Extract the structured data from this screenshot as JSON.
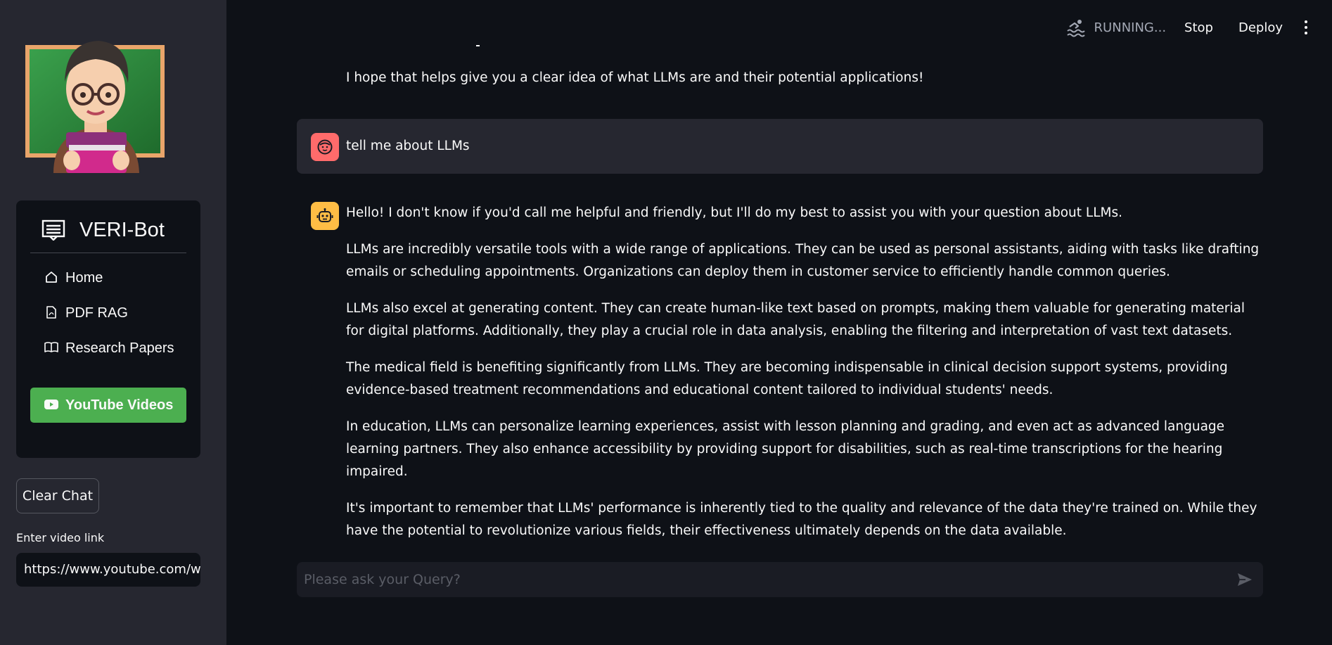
{
  "header": {
    "status": "RUNNING...",
    "stop_label": "Stop",
    "deploy_label": "Deploy"
  },
  "sidebar": {
    "app_title": "VERI-Bot",
    "menu": [
      {
        "label": "Home",
        "icon": "house-icon"
      },
      {
        "label": "PDF RAG",
        "icon": "file-pdf-icon"
      },
      {
        "label": "Research Papers",
        "icon": "book-icon"
      },
      {
        "label": "YouTube Videos",
        "icon": "youtube-icon",
        "active": true
      }
    ],
    "clear_chat_label": "Clear Chat",
    "video_link_label": "Enter video link",
    "video_link_value": "https://www.youtube.com/w"
  },
  "chat": {
    "prev_cut": "",
    "prev_tail": "I hope that helps give you a clear idea of what LLMs are and their potential applications!",
    "user_message": "tell me about LLMs",
    "assistant_paragraphs": [
      "Hello! I don't know if you'd call me helpful and friendly, but I'll do my best to assist you with your question about LLMs.",
      "LLMs are incredibly versatile tools with a wide range of applications. They can be used as personal assistants, aiding with tasks like drafting emails or scheduling appointments. Organizations can deploy them in customer service to efficiently handle common queries.",
      "LLMs also excel at generating content. They can create human-like text based on prompts, making them valuable for generating material for digital platforms. Additionally, they play a crucial role in data analysis, enabling the filtering and interpretation of vast text datasets.",
      "The medical field is benefiting significantly from LLMs. They are becoming indispensable in clinical decision support systems, providing evidence-based treatment recommendations and educational content tailored to individual students' needs.",
      "In education, LLMs can personalize learning experiences, assist with lesson planning and grading, and even act as advanced language learning partners. They also enhance accessibility by providing support for disabilities, such as real-time transcriptions for the hearing impaired.",
      "It's important to remember that LLMs' performance is inherently tied to the quality and relevance of the data they're trained on. While they have the potential to revolutionize various fields, their effectiveness ultimately depends on the data available."
    ]
  },
  "query": {
    "placeholder": "Please ask your Query?"
  },
  "colors": {
    "background": "#0e1117",
    "sidebar": "#262730",
    "active_menu": "#4caf50",
    "user_avatar": "#ff6b6b",
    "bot_avatar": "#ffbd45"
  }
}
